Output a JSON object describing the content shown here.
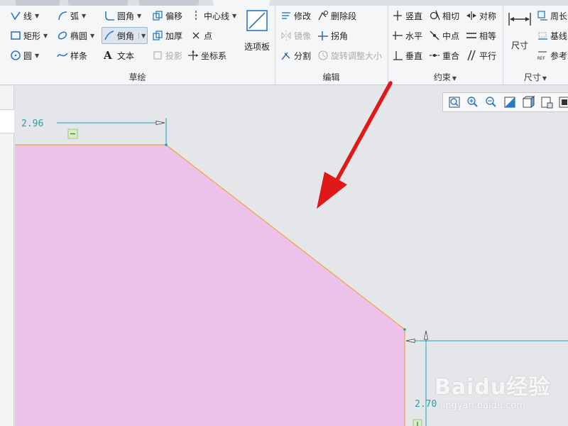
{
  "ribbon": {
    "sketch_group": {
      "label": "草绘",
      "line": "线",
      "arc": "弧",
      "fillet": "圆角",
      "offset": "偏移",
      "centerline": "中心线",
      "rectangle": "矩形",
      "ellipse": "椭圆",
      "chamfer": "倒角",
      "thicken": "加厚",
      "point": "点",
      "circle": "圆",
      "spline": "样条",
      "text": "文本",
      "project": "投影",
      "coord_system": "坐标系",
      "palette": "选项板"
    },
    "edit_group": {
      "label": "编辑",
      "modify": "修改",
      "delete_segment": "删除段",
      "mirror": "镜像",
      "corner": "拐角",
      "divide": "分割",
      "rotate_resize": "旋转调整大小"
    },
    "constraint_group": {
      "label": "约束",
      "vertical": "竖直",
      "tangent": "相切",
      "symmetric": "对称",
      "horizontal": "水平",
      "midpoint": "中点",
      "equal": "相等",
      "perpendicular": "垂直",
      "coincident": "重合",
      "parallel": "平行"
    },
    "dimension_group": {
      "label": "尺寸",
      "dimension": "尺寸",
      "perimeter": "周长",
      "baseline": "基线",
      "reference": "参考"
    }
  },
  "canvas": {
    "dim_top": "2.96",
    "dim_right": "2.70",
    "shape_fill": "#ecc1ea",
    "shape_edge": "#f0a33a",
    "dim_color": "#1aa3b5",
    "arrow_color": "#e01818",
    "background": "#e4e6e9"
  },
  "view_toolbar": {
    "icons": [
      "zoom-fit-icon",
      "zoom-in-icon",
      "zoom-out-icon",
      "repaint-icon",
      "display-style-icon",
      "saved-views-icon",
      "more-icon"
    ]
  },
  "watermark": {
    "brand": "Baidu经验",
    "url": "jingyan.baidu.com"
  }
}
